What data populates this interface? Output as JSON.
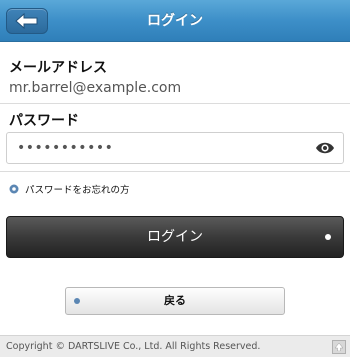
{
  "header": {
    "title": "ログイン",
    "back_icon": "back-arrow-icon",
    "color": "#3d8fc8"
  },
  "email": {
    "label": "メールアドレス",
    "value": "mr.barrel@example.com"
  },
  "password": {
    "label": "パスワード",
    "value": "•••••••••••",
    "toggle_icon": "eye-icon"
  },
  "forgot_link": {
    "label": "パスワードをお忘れの方",
    "bullet_icon": "circle-bullet-icon"
  },
  "login_button": {
    "label": "ログイン"
  },
  "back_button": {
    "label": "戻る"
  },
  "footer": {
    "copyright": "Copyright © DARTSLIVE Co., Ltd. All Rights Reserved.",
    "top_icon": "scroll-top-icon"
  }
}
